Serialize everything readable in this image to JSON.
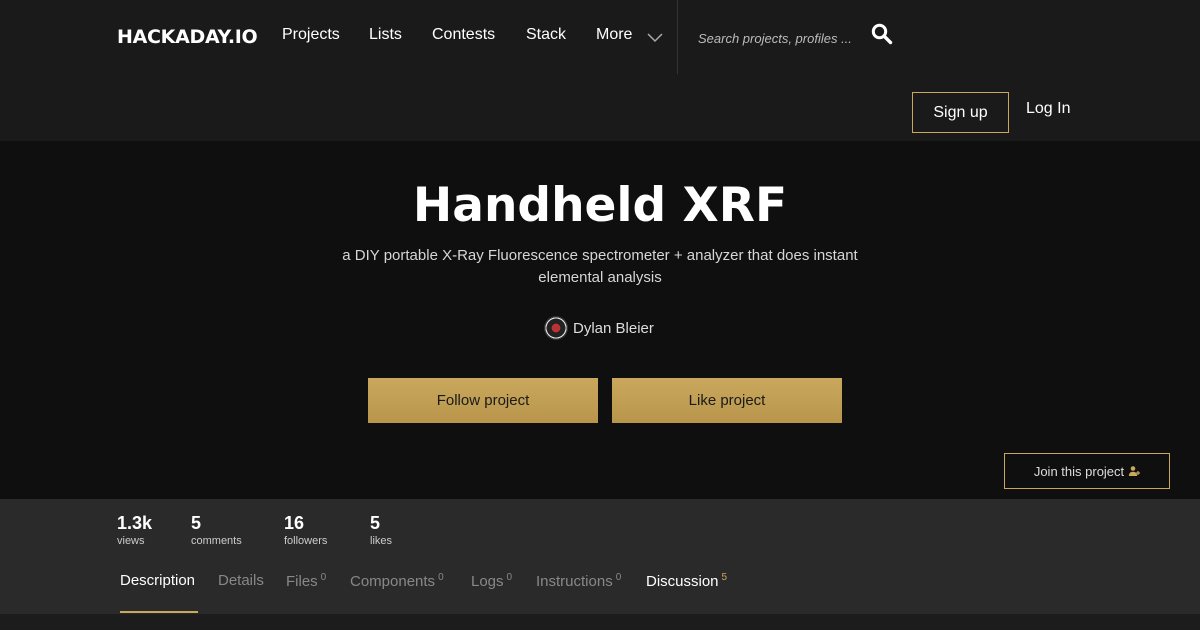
{
  "header": {
    "logo": "HACKADAY.IO",
    "nav": [
      "Projects",
      "Lists",
      "Contests",
      "Stack",
      "More"
    ],
    "search_placeholder": "Search projects, profiles ...",
    "signup": "Sign up",
    "login": "Log In"
  },
  "project": {
    "title": "Handheld XRF",
    "subtitle": "a DIY portable X-Ray Fluorescence spectrometer + analyzer that does instant elemental analysis",
    "author": "Dylan Bleier",
    "follow_label": "Follow project",
    "like_label": "Like project",
    "join_label": "Join this project"
  },
  "stats": [
    {
      "value": "1.3k",
      "label": "views"
    },
    {
      "value": "5",
      "label": "comments"
    },
    {
      "value": "16",
      "label": "followers"
    },
    {
      "value": "5",
      "label": "likes"
    }
  ],
  "tabs": [
    {
      "label": "Description",
      "count": ""
    },
    {
      "label": "Details",
      "count": ""
    },
    {
      "label": "Files",
      "count": "0"
    },
    {
      "label": "Components",
      "count": "0"
    },
    {
      "label": "Logs",
      "count": "0"
    },
    {
      "label": "Instructions",
      "count": "0"
    },
    {
      "label": "Discussion",
      "count": "5"
    }
  ],
  "colors": {
    "accent": "#c9a75b",
    "header_bg": "#1a1a1a",
    "hero_bg": "#0f0f0f",
    "stats_bg": "#2a2a2a"
  },
  "icons": {
    "search": "search-icon",
    "more": "chevron-down-icon",
    "join": "user-plus-icon"
  }
}
